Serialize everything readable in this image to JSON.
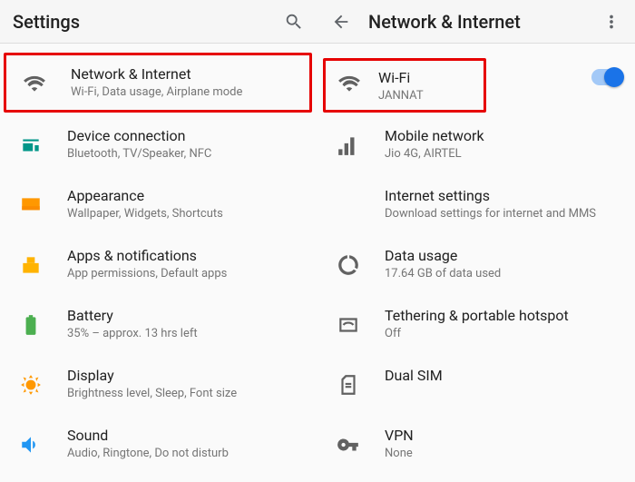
{
  "left": {
    "title": "Settings",
    "items": [
      {
        "label": "Network & Internet",
        "sub": "Wi-Fi, Data usage, Airplane mode"
      },
      {
        "label": "Device connection",
        "sub": "Bluetooth, TV/Speaker, NFC"
      },
      {
        "label": "Appearance",
        "sub": "Wallpaper, Widgets, Shortcuts"
      },
      {
        "label": "Apps & notifications",
        "sub": "App permissions, Default apps"
      },
      {
        "label": "Battery",
        "sub": "35% – approx. 13 hrs left"
      },
      {
        "label": "Display",
        "sub": "Brightness level, Sleep, Font size"
      },
      {
        "label": "Sound",
        "sub": "Audio, Ringtone, Do not disturb"
      }
    ]
  },
  "right": {
    "title": "Network & Internet",
    "items": [
      {
        "label": "Wi-Fi",
        "sub": "JANNAT"
      },
      {
        "label": "Mobile network",
        "sub": "Jio 4G, AIRTEL"
      },
      {
        "label": "Internet settings",
        "sub": "Download settings for internet and MMS"
      },
      {
        "label": "Data usage",
        "sub": "17.64 GB of data used"
      },
      {
        "label": "Tethering & portable hotspot",
        "sub": "Off"
      },
      {
        "label": "Dual SIM",
        "sub": ""
      },
      {
        "label": "VPN",
        "sub": "None"
      }
    ]
  }
}
